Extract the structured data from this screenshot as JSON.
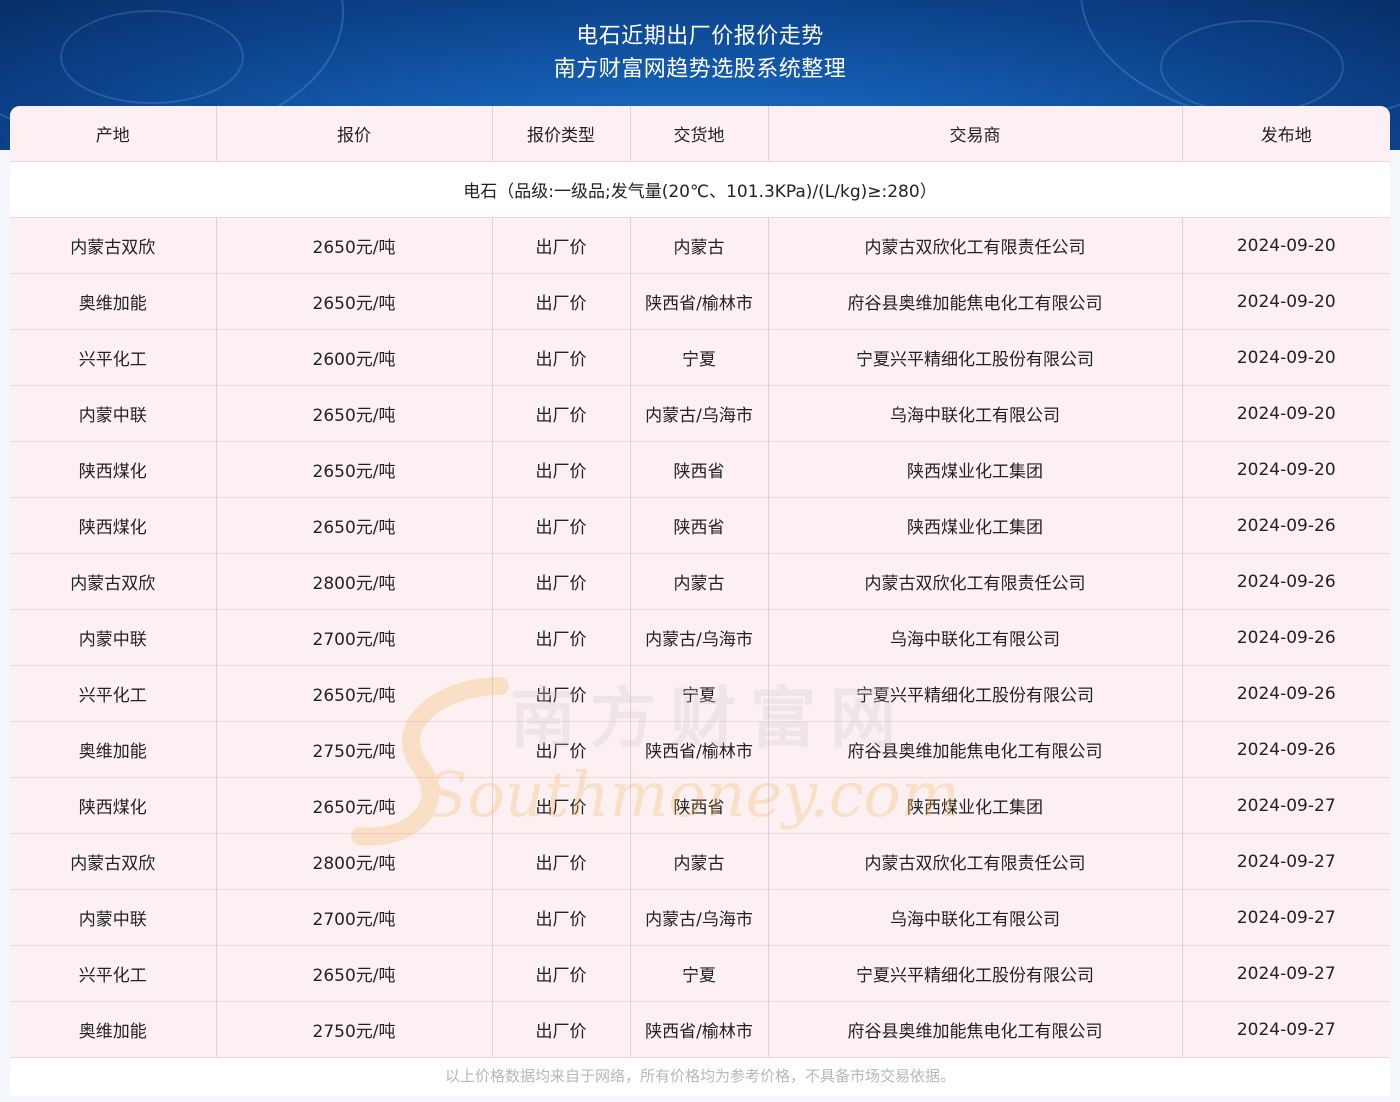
{
  "header": {
    "title_line1": "电石近期出厂价报价走势",
    "title_line2": "南方财富网趋势选股系统整理"
  },
  "table": {
    "columns": [
      "产地",
      "报价",
      "报价类型",
      "交货地",
      "交易商",
      "发布地"
    ],
    "category": "电石（品级:一级品;发气量(20℃、101.3KPa)/(L/kg)≥:280）",
    "rows": [
      [
        "内蒙古双欣",
        "2650元/吨",
        "出厂价",
        "内蒙古",
        "内蒙古双欣化工有限责任公司",
        "2024-09-20"
      ],
      [
        "奥维加能",
        "2650元/吨",
        "出厂价",
        "陕西省/榆林市",
        "府谷县奥维加能焦电化工有限公司",
        "2024-09-20"
      ],
      [
        "兴平化工",
        "2600元/吨",
        "出厂价",
        "宁夏",
        "宁夏兴平精细化工股份有限公司",
        "2024-09-20"
      ],
      [
        "内蒙中联",
        "2650元/吨",
        "出厂价",
        "内蒙古/乌海市",
        "乌海中联化工有限公司",
        "2024-09-20"
      ],
      [
        "陕西煤化",
        "2650元/吨",
        "出厂价",
        "陕西省",
        "陕西煤业化工集团",
        "2024-09-20"
      ],
      [
        "陕西煤化",
        "2650元/吨",
        "出厂价",
        "陕西省",
        "陕西煤业化工集团",
        "2024-09-26"
      ],
      [
        "内蒙古双欣",
        "2800元/吨",
        "出厂价",
        "内蒙古",
        "内蒙古双欣化工有限责任公司",
        "2024-09-26"
      ],
      [
        "内蒙中联",
        "2700元/吨",
        "出厂价",
        "内蒙古/乌海市",
        "乌海中联化工有限公司",
        "2024-09-26"
      ],
      [
        "兴平化工",
        "2650元/吨",
        "出厂价",
        "宁夏",
        "宁夏兴平精细化工股份有限公司",
        "2024-09-26"
      ],
      [
        "奥维加能",
        "2750元/吨",
        "出厂价",
        "陕西省/榆林市",
        "府谷县奥维加能焦电化工有限公司",
        "2024-09-26"
      ],
      [
        "陕西煤化",
        "2650元/吨",
        "出厂价",
        "陕西省",
        "陕西煤业化工集团",
        "2024-09-27"
      ],
      [
        "内蒙古双欣",
        "2800元/吨",
        "出厂价",
        "内蒙古",
        "内蒙古双欣化工有限责任公司",
        "2024-09-27"
      ],
      [
        "内蒙中联",
        "2700元/吨",
        "出厂价",
        "内蒙古/乌海市",
        "乌海中联化工有限公司",
        "2024-09-27"
      ],
      [
        "兴平化工",
        "2650元/吨",
        "出厂价",
        "宁夏",
        "宁夏兴平精细化工股份有限公司",
        "2024-09-27"
      ],
      [
        "奥维加能",
        "2750元/吨",
        "出厂价",
        "陕西省/榆林市",
        "府谷县奥维加能焦电化工有限公司",
        "2024-09-27"
      ]
    ]
  },
  "watermark": {
    "chinese": "南方财富网",
    "latin": "Southmoney.com"
  },
  "footer": {
    "note": "以上价格数据均来自于网络，所有价格均为参考价格，不具备市场交易依据。"
  },
  "colors": {
    "banner": "#0b3f86",
    "row_bg": "#fdf0f3",
    "border": "#efc8d3",
    "watermark": "#f3b45a"
  }
}
